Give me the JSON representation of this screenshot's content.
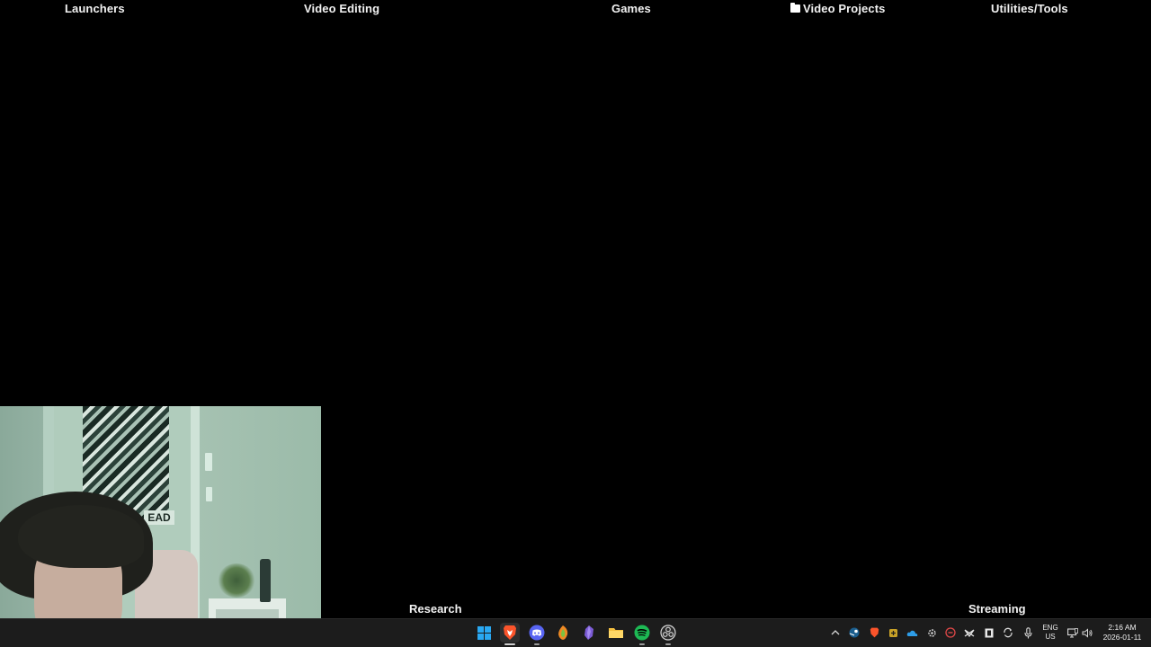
{
  "desktop": {
    "top_labels": [
      "Launchers",
      "Video Editing",
      "Games",
      "Video Projects",
      "Utilities/Tools"
    ],
    "bottom_labels": [
      "Research",
      "Streaming"
    ],
    "webcam_text": "EAD"
  },
  "taskbar": {
    "apps": [
      {
        "name": "start",
        "icon": "windows-logo-icon"
      },
      {
        "name": "brave-browser",
        "icon": "brave-icon",
        "active": true
      },
      {
        "name": "discord",
        "icon": "discord-icon"
      },
      {
        "name": "fl-studio",
        "icon": "fl-studio-icon"
      },
      {
        "name": "obsidian",
        "icon": "obsidian-icon"
      },
      {
        "name": "file-explorer",
        "icon": "folder-icon"
      },
      {
        "name": "spotify",
        "icon": "spotify-icon"
      },
      {
        "name": "obs-studio",
        "icon": "obs-icon"
      }
    ],
    "tray": {
      "language": "ENG",
      "region": "US",
      "time": "2:16 AM",
      "date": "2026-01-11"
    }
  },
  "colors": {
    "desktop_bg": "#000000",
    "taskbar_bg": "#1c1c1c",
    "windows_blue": "#29a8f2",
    "brave_orange": "#fb542b",
    "discord_blurple": "#5865f2",
    "spotify_green": "#1db954",
    "obsidian_purple": "#7c5cd6",
    "folder_yellow": "#f5c040"
  }
}
